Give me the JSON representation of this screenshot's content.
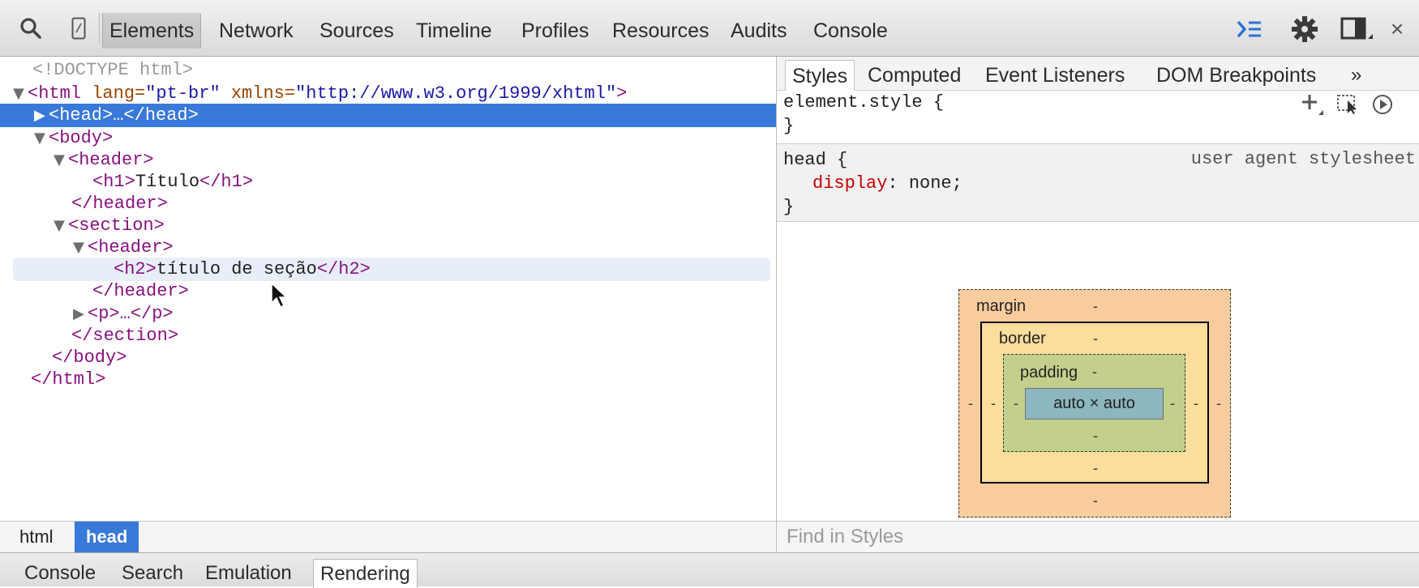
{
  "toolbar": {
    "tabs": [
      "Elements",
      "Network",
      "Sources",
      "Timeline",
      "Profiles",
      "Resources",
      "Audits",
      "Console"
    ],
    "active_tab": "Elements",
    "left_icons": [
      "search-icon",
      "device-mode-icon"
    ],
    "right_icons": [
      "console-drawer-icon",
      "gear-icon",
      "dock-icon",
      "close-icon"
    ],
    "close_glyph": "×",
    "accent_color": "#3879d9"
  },
  "dom_tree": {
    "doctype": "<!DOCTYPE html>",
    "html_open_tag": "<html",
    "html_attr1_name": " lang=",
    "html_attr1_value": "\"pt-br\"",
    "html_attr2_name": " xmlns=",
    "html_attr2_value": "\"http://www.w3.org/1999/xhtml\"",
    "gt": ">",
    "head_collapsed": "<head>…</head>",
    "body_open": "<body>",
    "header_open": "<header>",
    "h1_open": "<h1>",
    "h1_text": "Título",
    "h1_close": "</h1>",
    "header_close": "</header>",
    "section_open": "<section>",
    "h2_open": "<h2>",
    "h2_text": "título de seção",
    "h2_close": "</h2>",
    "p_collapsed": "<p>…</p>",
    "section_close": "</section>",
    "body_close": "</body>",
    "html_close": "</html>"
  },
  "breadcrumb": [
    "html",
    "head"
  ],
  "styles_panel": {
    "tabs": [
      "Styles",
      "Computed",
      "Event Listeners",
      "DOM Breakpoints"
    ],
    "more_glyph": "»",
    "active_tab": "Styles",
    "element_style_selector": "element.style {",
    "close_brace": "}",
    "head_selector": "head {",
    "head_property": "display",
    "head_colon": ":",
    "head_value": " none;",
    "head_source": "user agent stylesheet"
  },
  "box_model": {
    "margin_label": "margin",
    "border_label": "border",
    "padding_label": "padding",
    "content_size": "auto × auto",
    "dash": "-"
  },
  "find_in_styles_placeholder": "Find in Styles",
  "drawer": {
    "tabs": [
      "Console",
      "Search",
      "Emulation",
      "Rendering"
    ],
    "active_tab": "Rendering"
  }
}
